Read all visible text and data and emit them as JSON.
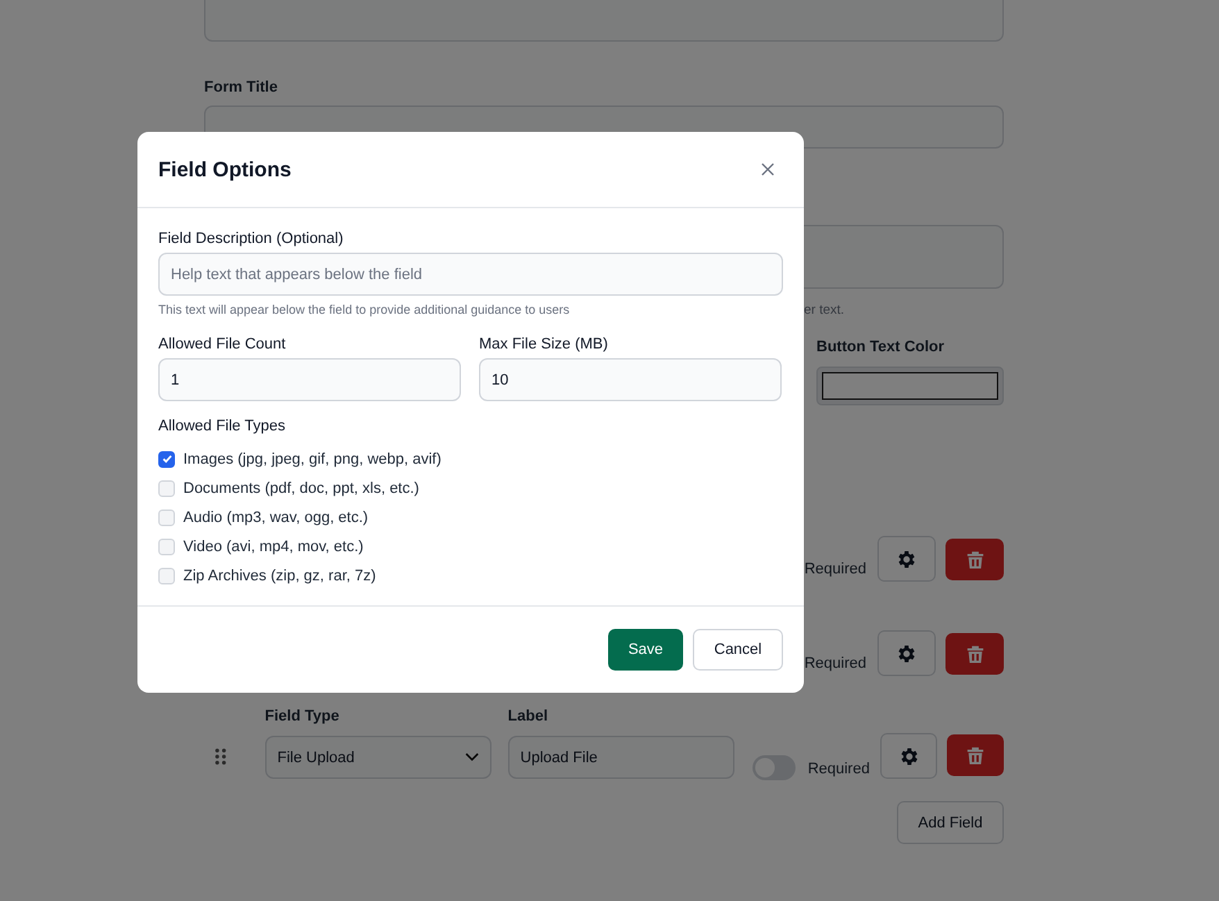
{
  "page": {
    "form_title_label": "Form Title",
    "textarea_hint": "er text.",
    "button_text_color_label": "Button Text Color",
    "fields": [
      {
        "kind": "partial",
        "required_label": "Required"
      },
      {
        "kind": "partial",
        "required_label": "Required"
      },
      {
        "kind": "full",
        "field_type_label": "Field Type",
        "field_type": "File Upload",
        "label_label": "Label",
        "label_value": "Upload File",
        "required": false,
        "required_label": "Required"
      }
    ],
    "add_field_button": "Add Field"
  },
  "modal": {
    "title": "Field Options",
    "description": {
      "label": "Field Description (Optional)",
      "placeholder": "Help text that appears below the field",
      "hint": "This text will appear below the field to provide additional guidance to users"
    },
    "file_count": {
      "label": "Allowed File Count",
      "value": "1"
    },
    "max_file_size": {
      "label": "Max File Size (MB)",
      "value": "10"
    },
    "file_types_label": "Allowed File Types",
    "file_types": [
      {
        "label": "Images (jpg, jpeg, gif, png, webp, avif)",
        "checked": true
      },
      {
        "label": "Documents (pdf, doc, ppt, xls, etc.)",
        "checked": false
      },
      {
        "label": "Audio (mp3, wav, ogg, etc.)",
        "checked": false
      },
      {
        "label": "Video (avi, mp4, mov, etc.)",
        "checked": false
      },
      {
        "label": "Zip Archives (zip, gz, rar, 7z)",
        "checked": false
      }
    ],
    "buttons": [
      {
        "kind": "primary",
        "label": "Save"
      },
      {
        "kind": "secondary",
        "label": "Cancel"
      }
    ]
  }
}
